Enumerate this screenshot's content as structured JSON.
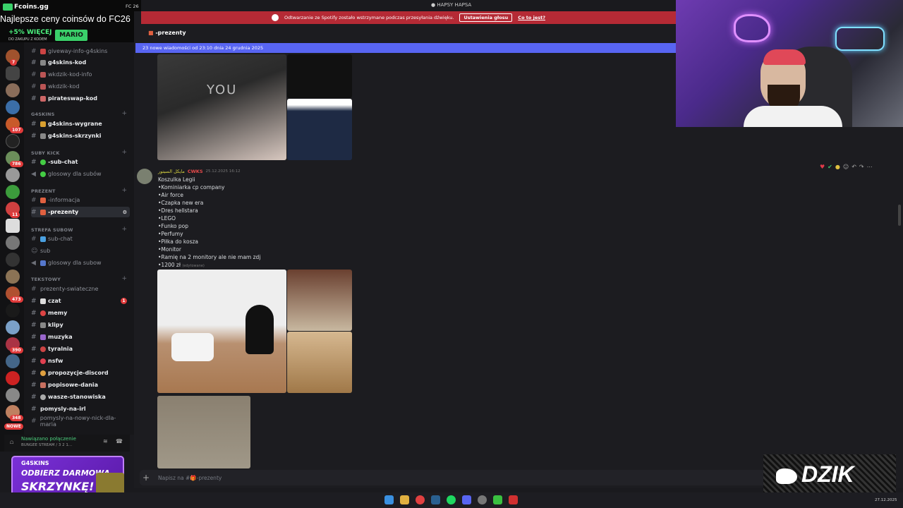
{
  "window": {
    "title": "HAPSY HAPSA"
  },
  "overlay": {
    "brand": "Fcoins.gg",
    "stream_status": "FC 26",
    "headline": "Najlepsze ceny coinsów do FC26",
    "bonus": "+5% WIĘCEJ",
    "bonus_sub": "DO ZAKUPU Z KODEM",
    "code": "MARIO"
  },
  "spotify_bar": {
    "text": "Odtwarzanie ze Spotify zostało wstrzymane podczas przesyłania dźwięku.",
    "button": "Ustawienia głosu",
    "link": "Co to jest?"
  },
  "channel_header": {
    "name": "-prezenty"
  },
  "new_messages_bar": "23 nowe wiadomości od 23:10 dnia 24 grudnia 2025",
  "sidebar": {
    "items": [
      {
        "label": "giveway-info-g4skins",
        "bold": false
      },
      {
        "label": "g4skins-kod",
        "bold": true
      },
      {
        "label": "wkdzik-kod-info",
        "bold": false
      },
      {
        "label": "wkdzik-kod",
        "bold": false
      },
      {
        "label": "pirateswap-kod",
        "bold": true
      },
      {
        "label": "g4skins-wygrane",
        "bold": true
      },
      {
        "label": "g4skins-skrzynki",
        "bold": true
      },
      {
        "label": "-sub-chat",
        "bold": true
      },
      {
        "label": "glosowy dla subów",
        "bold": false
      },
      {
        "label": "-informacja",
        "bold": false
      },
      {
        "label": "-prezenty",
        "bold": true
      },
      {
        "label": "sub-chat",
        "bold": false
      },
      {
        "label": "sub",
        "bold": false
      },
      {
        "label": "glosowy dla subow",
        "bold": false
      },
      {
        "label": "prezenty-swiateczne",
        "bold": false
      },
      {
        "label": "czat",
        "bold": true
      },
      {
        "label": "memy",
        "bold": true
      },
      {
        "label": "klipy",
        "bold": true
      },
      {
        "label": "muzyka",
        "bold": true
      },
      {
        "label": "tyralnia",
        "bold": true
      },
      {
        "label": "nsfw",
        "bold": true
      },
      {
        "label": "propozycje-discord",
        "bold": true
      },
      {
        "label": "popisowe-dania",
        "bold": true
      },
      {
        "label": "wasze-stanowiska",
        "bold": true
      },
      {
        "label": "pomysly-na-irl",
        "bold": true
      },
      {
        "label": "pomysly-na-nowy-nick-dla-maria",
        "bold": false
      }
    ],
    "categories": {
      "g4skins": "G4SKINS",
      "suby_kick": "SUBY KICK",
      "prezent": "PREZENT",
      "strefa": "STREFA SUBOW",
      "tekstowy": "TEKSTOWY"
    },
    "badges": {
      "czat": "1"
    },
    "server_badges": [
      "7",
      "5",
      "8",
      "107",
      "786",
      "32",
      "11",
      "10",
      "27",
      "473",
      "10",
      "25",
      "390",
      "365",
      "348",
      "NOWE"
    ]
  },
  "voice": {
    "status": "Nawiązano połączenie",
    "detail": "BUNGEE STREAM / 3 2 1..."
  },
  "message": {
    "author": "مايكل السيتور",
    "tag": "CWKS",
    "time": "25.12.2025 16:12",
    "lines": [
      "Koszulka Legii",
      "•Kominiarka cp company",
      "•Air force",
      "•Czapka new era",
      "•Dres hellstara",
      "•LEGO",
      "•Funko pop",
      "•Perfumy",
      "•Piłka do kosza",
      "•Monitor",
      "•Ramię na 2 monitory ale nie mam zdj",
      "•1200 zł"
    ],
    "edited": "(edytowane)"
  },
  "composer": {
    "placeholder": "Napisz na #🎁-prezenty"
  },
  "bottom_ad": {
    "brand": "G4SKINS",
    "line1": "ODBIERZ DARMOWĄ",
    "line2": "SKRZYNKĘ!"
  },
  "dzik_logo": "DZIK",
  "taskbar": {
    "date": "27.12.2025"
  }
}
